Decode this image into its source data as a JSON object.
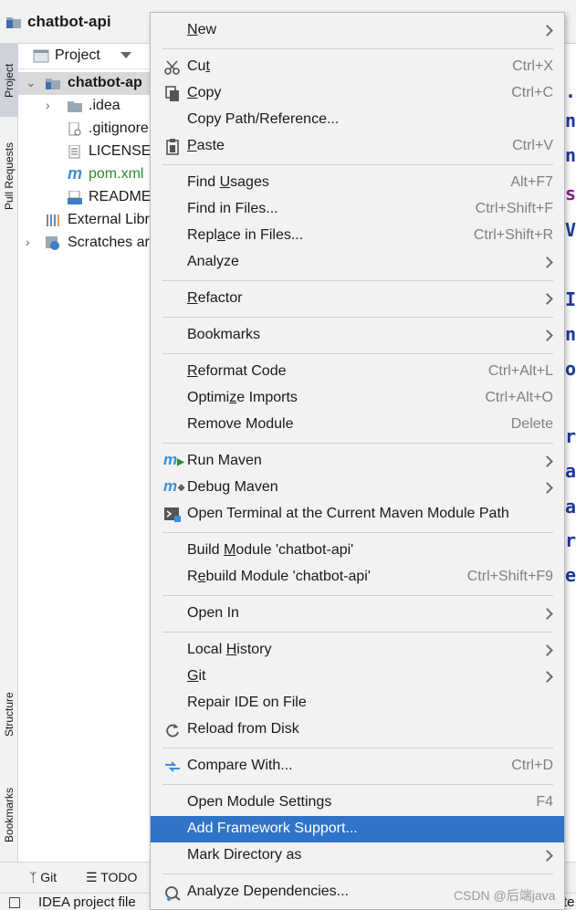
{
  "window": {
    "title": "chatbot-api"
  },
  "left_strip": {
    "project_tab": "Project",
    "pull_requests_tab": "Pull Requests",
    "structure_tab": "Structure",
    "bookmarks_tab": "Bookmarks"
  },
  "project_panel": {
    "header_label": "Project",
    "tree": [
      {
        "label": "chatbot-ap",
        "icon": "folder-module-icon",
        "expanded": true,
        "selected": true
      },
      {
        "label": ".idea",
        "icon": "folder-icon",
        "expanded": false
      },
      {
        "label": ".gitignore",
        "icon": "gitignore-file-icon"
      },
      {
        "label": "LICENSE",
        "icon": "text-file-icon"
      },
      {
        "label": "pom.xml",
        "icon": "maven-icon",
        "color": "#2c8a2c"
      },
      {
        "label": "README",
        "icon": "markdown-file-icon"
      },
      {
        "label": "External Libr",
        "icon": "library-icon"
      },
      {
        "label": "Scratches ar",
        "icon": "scratches-icon",
        "expanded": false
      }
    ]
  },
  "editor_fragments": [
    ".c",
    "nl",
    "nl",
    "si",
    "Ve",
    "Id",
    "nc",
    "or",
    "rt",
    "av",
    "av",
    "ro",
    "er"
  ],
  "context_menu": {
    "items": [
      {
        "label": "New",
        "mnemonic": "N",
        "shortcut": "",
        "submenu": true,
        "icon": ""
      },
      {
        "label": "Cut",
        "mnemonic": "t",
        "shortcut": "Ctrl+X",
        "submenu": false,
        "icon": "scissors-icon"
      },
      {
        "label": "Copy",
        "mnemonic": "C",
        "shortcut": "Ctrl+C",
        "submenu": false,
        "icon": "copy-icon"
      },
      {
        "label": "Copy Path/Reference...",
        "shortcut": "",
        "submenu": false,
        "icon": ""
      },
      {
        "label": "Paste",
        "mnemonic": "P",
        "shortcut": "Ctrl+V",
        "submenu": false,
        "icon": "clipboard-icon"
      },
      {
        "label": "Find Usages",
        "mnemonic": "U",
        "shortcut": "Alt+F7",
        "submenu": false,
        "icon": ""
      },
      {
        "label": "Find in Files...",
        "shortcut": "Ctrl+Shift+F",
        "submenu": false,
        "icon": ""
      },
      {
        "label": "Replace in Files...",
        "mnemonic": "a",
        "shortcut": "Ctrl+Shift+R",
        "submenu": false,
        "icon": ""
      },
      {
        "label": "Analyze",
        "shortcut": "",
        "submenu": true,
        "icon": ""
      },
      {
        "label": "Refactor",
        "mnemonic": "R",
        "shortcut": "",
        "submenu": true,
        "icon": ""
      },
      {
        "label": "Bookmarks",
        "shortcut": "",
        "submenu": true,
        "icon": ""
      },
      {
        "label": "Reformat Code",
        "mnemonic": "R",
        "shortcut": "Ctrl+Alt+L",
        "submenu": false,
        "icon": ""
      },
      {
        "label": "Optimize Imports",
        "mnemonic": "z",
        "shortcut": "Ctrl+Alt+O",
        "submenu": false,
        "icon": ""
      },
      {
        "label": "Remove Module",
        "shortcut": "Delete",
        "submenu": false,
        "icon": ""
      },
      {
        "label": "Run Maven",
        "shortcut": "",
        "submenu": true,
        "icon": "maven-run-icon"
      },
      {
        "label": "Debug Maven",
        "shortcut": "",
        "submenu": true,
        "icon": "maven-debug-icon"
      },
      {
        "label": "Open Terminal at the Current Maven Module Path",
        "shortcut": "",
        "submenu": false,
        "icon": "terminal-icon"
      },
      {
        "label": "Build Module 'chatbot-api'",
        "mnemonic": "M",
        "shortcut": "",
        "submenu": false,
        "icon": ""
      },
      {
        "label": "Rebuild Module 'chatbot-api'",
        "mnemonic": "e",
        "shortcut": "Ctrl+Shift+F9",
        "submenu": false,
        "icon": ""
      },
      {
        "label": "Open In",
        "shortcut": "",
        "submenu": true,
        "icon": ""
      },
      {
        "label": "Local History",
        "mnemonic": "H",
        "shortcut": "",
        "submenu": true,
        "icon": ""
      },
      {
        "label": "Git",
        "mnemonic": "G",
        "shortcut": "",
        "submenu": true,
        "icon": ""
      },
      {
        "label": "Repair IDE on File",
        "shortcut": "",
        "submenu": false,
        "icon": ""
      },
      {
        "label": "Reload from Disk",
        "shortcut": "",
        "submenu": false,
        "icon": "reload-icon"
      },
      {
        "label": "Compare With...",
        "shortcut": "Ctrl+D",
        "submenu": false,
        "icon": "compare-icon"
      },
      {
        "label": "Open Module Settings",
        "shortcut": "F4",
        "submenu": false,
        "icon": ""
      },
      {
        "label": "Add Framework Support...",
        "shortcut": "",
        "submenu": false,
        "icon": "",
        "highlighted": true
      },
      {
        "label": "Mark Directory as",
        "shortcut": "",
        "submenu": true,
        "icon": ""
      },
      {
        "label": "Analyze Dependencies...",
        "shortcut": "",
        "submenu": false,
        "icon": "dependencies-icon"
      }
    ]
  },
  "bottom_bar": {
    "git_tab": "Git",
    "todo_tab": "TODO"
  },
  "status_bar": {
    "text": "IDEA project file",
    "trailing": "te"
  },
  "watermark": "CSDN @后端java",
  "colors": {
    "highlight": "#2f74c8",
    "menu_bg": "#f2f2f2",
    "maven_green": "#2c8a2c",
    "code_blue": "#1c3a9b"
  }
}
